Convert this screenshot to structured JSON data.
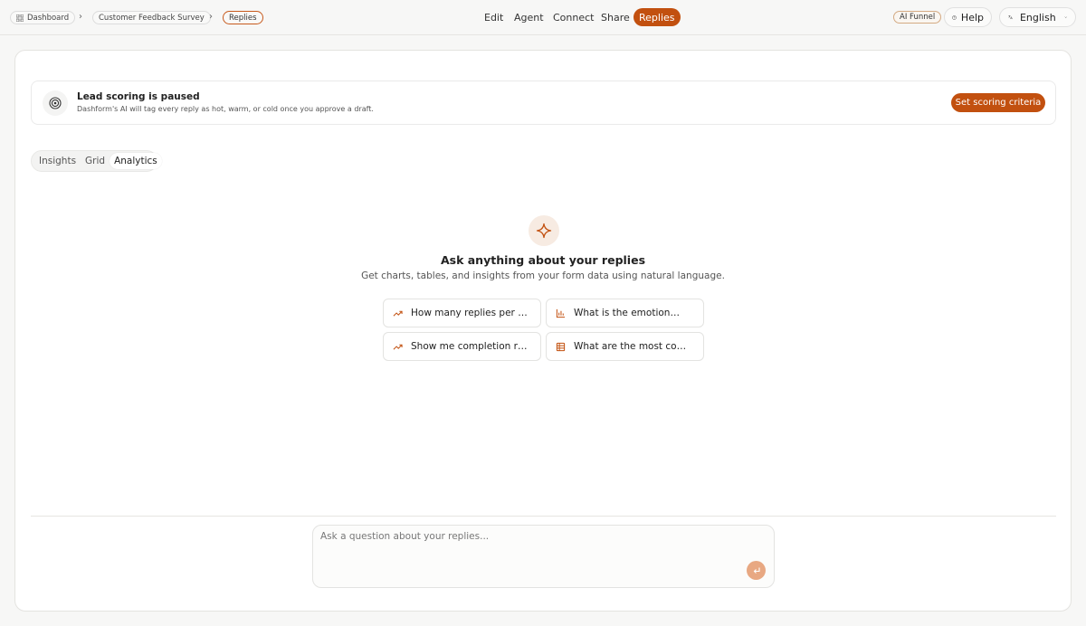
{
  "breadcrumb": {
    "items": [
      {
        "label": "Dashboard",
        "icon": "grid-icon"
      },
      {
        "label": "Customer Feedback Survey"
      },
      {
        "label": "Replies"
      }
    ]
  },
  "nav": {
    "items": [
      "Edit",
      "Agent",
      "Connect",
      "Share",
      "Replies"
    ],
    "active": "Replies"
  },
  "header_right": {
    "ai_funnel": "AI Funnel",
    "help": "Help",
    "language": "English"
  },
  "banner": {
    "title": "Lead scoring is paused",
    "subtitle": "Dashform's AI will tag every reply as hot, warm, or cold once you approve a draft.",
    "button": "Set scoring criteria",
    "icon": "target-icon"
  },
  "tabs": {
    "items": [
      "Insights",
      "Grid",
      "Analytics"
    ],
    "active": "Analytics"
  },
  "hero": {
    "icon": "sparkle-icon",
    "title": "Ask anything about your replies",
    "subtitle": "Get charts, tables, and insights from your form data using natural language."
  },
  "suggestions": [
    {
      "label": "How many replies per day…",
      "icon": "trend-icon"
    },
    {
      "label": "What is the emotion…",
      "icon": "bar-chart-icon"
    },
    {
      "label": "Show me completion rate…",
      "icon": "trend-icon"
    },
    {
      "label": "What are the most commo…",
      "icon": "table-icon"
    }
  ],
  "ask": {
    "placeholder": "Ask a question about your replies..."
  },
  "colors": {
    "accent": "#c2500f",
    "accent_light": "#e8a882",
    "sparkle_bg": "#f7ebe2"
  }
}
